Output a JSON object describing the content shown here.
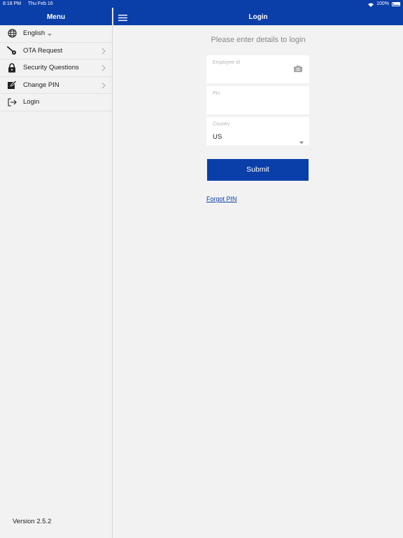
{
  "status_bar": {
    "time": "8:18 PM",
    "date": "Thu Feb 16",
    "battery": "100%"
  },
  "sidebar": {
    "title": "Menu",
    "items": [
      {
        "label": "English",
        "icon": "globe-icon"
      },
      {
        "label": "OTA Request",
        "icon": "key-icon"
      },
      {
        "label": "Security Questions",
        "icon": "lock-icon"
      },
      {
        "label": "Change PIN",
        "icon": "edit-icon"
      },
      {
        "label": "Login",
        "icon": "login-icon"
      }
    ],
    "version": "Version 2.5.2"
  },
  "main": {
    "title": "Login",
    "prompt": "Please enter details to login",
    "employee_field": {
      "label": "Employee Id",
      "value": ""
    },
    "pin_field": {
      "label": "Pin",
      "value": ""
    },
    "country_field": {
      "label": "Country",
      "value": "US"
    },
    "submit_label": "Submit",
    "forgot_label": "Forgot PIN"
  },
  "colors": {
    "brand": "#0a3ea8",
    "background": "#f2f2f2"
  }
}
